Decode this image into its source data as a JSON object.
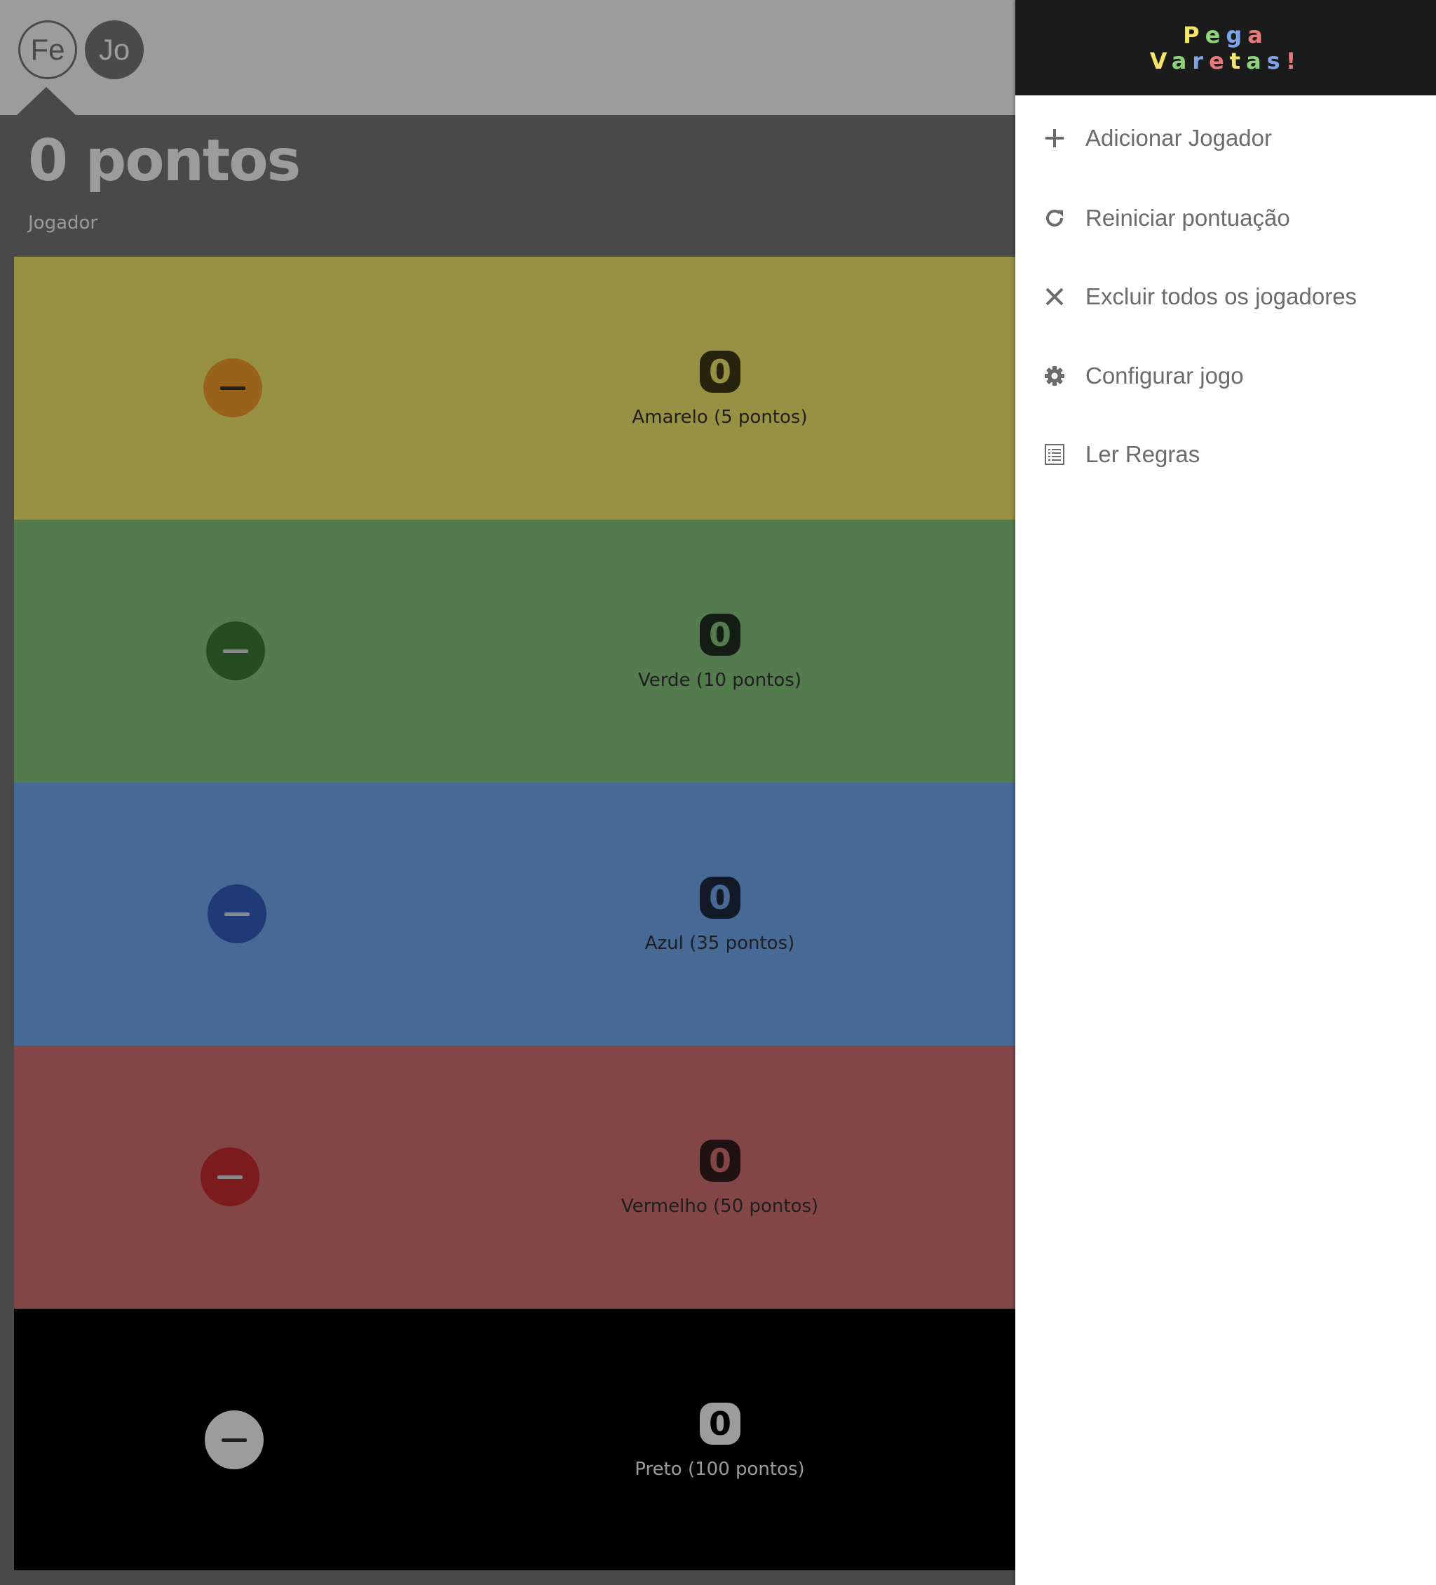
{
  "players": [
    {
      "initials": "Fe",
      "selected": true
    },
    {
      "initials": "Jo",
      "selected": false
    }
  ],
  "score": {
    "title": "0 pontos",
    "player_label": "Jogador"
  },
  "sticks": [
    {
      "count": "0",
      "label": "Amarelo (5 pontos)",
      "bg": "#979143",
      "btn": "#98621a",
      "bar": "#1f1f1f",
      "count_bg": "#26240f",
      "count_fg": "#979143",
      "label_color": "#1f1f1f"
    },
    {
      "count": "0",
      "label": "Verde (10 pontos)",
      "bg": "#537b4d",
      "btn": "#264d22",
      "bar": "#8a8a8a",
      "count_bg": "#141d13",
      "count_fg": "#537b4d",
      "label_color": "#1f1f1f"
    },
    {
      "count": "0",
      "label": "Azul (35 pontos)",
      "bg": "#476996",
      "btn": "#1f3a77",
      "bar": "#8a8a8a",
      "count_bg": "#111a26",
      "count_fg": "#476996",
      "label_color": "#1f1f1f"
    },
    {
      "count": "0",
      "label": "Vermelho (50 pontos)",
      "bg": "#824646",
      "btn": "#7c1b1d",
      "bar": "#8a8a8a",
      "count_bg": "#211212",
      "count_fg": "#824646",
      "label_color": "#1f1f1f"
    },
    {
      "count": "0",
      "label": "Preto (100 pontos)",
      "bg": "#000000",
      "btn": "#9c9c9c",
      "bar": "#1f1f1f",
      "count_bg": "#9c9c9c",
      "count_fg": "#000000",
      "label_color": "#9c9c9c"
    }
  ],
  "logo": {
    "line1": [
      "P",
      "e",
      "g",
      "a"
    ],
    "line2": [
      "V",
      "a",
      "r",
      "e",
      "t",
      "a",
      "s",
      "!"
    ],
    "line1_colors": [
      "#f5e66a",
      "#8ed37a",
      "#7ea3e6",
      "#e77a7a"
    ],
    "line2_colors": [
      "#f5e66a",
      "#8ed37a",
      "#7ea3e6",
      "#e77a7a",
      "#f5e66a",
      "#8ed37a",
      "#7ea3e6",
      "#e77a7a"
    ]
  },
  "menu": [
    {
      "label": "Adicionar Jogador",
      "icon": "plus-icon"
    },
    {
      "label": "Reiniciar pontuação",
      "icon": "refresh-icon"
    },
    {
      "label": "Excluir todos os jogadores",
      "icon": "close-icon"
    },
    {
      "label": "Configurar jogo",
      "icon": "gear-icon"
    },
    {
      "label": "Ler Regras",
      "icon": "list-icon"
    }
  ]
}
